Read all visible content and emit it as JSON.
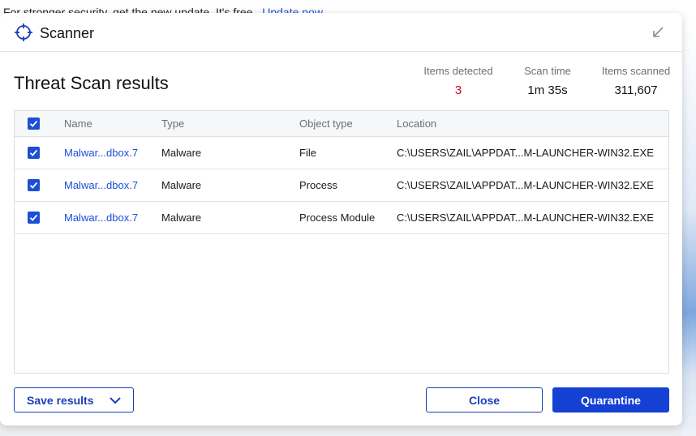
{
  "background": {
    "banner_text": "For stronger security, get the new update. It's free.",
    "banner_link": "Update now"
  },
  "header": {
    "title": "Scanner",
    "icon": "crosshair-icon",
    "minimize_icon": "minimize-arrow-icon"
  },
  "results": {
    "title": "Threat Scan results",
    "stats": {
      "items_detected_label": "Items detected",
      "items_detected_value": "3",
      "scan_time_label": "Scan time",
      "scan_time_value": "1m 35s",
      "items_scanned_label": "Items scanned",
      "items_scanned_value": "311,607"
    }
  },
  "table": {
    "columns": [
      "Name",
      "Type",
      "Object type",
      "Location"
    ],
    "rows": [
      {
        "name": "Malwar...dbox.7",
        "type": "Malware",
        "object_type": "File",
        "location": "C:\\USERS\\ZAIL\\APPDAT...M-LAUNCHER-WIN32.EXE",
        "checked": true
      },
      {
        "name": "Malwar...dbox.7",
        "type": "Malware",
        "object_type": "Process",
        "location": "C:\\USERS\\ZAIL\\APPDAT...M-LAUNCHER-WIN32.EXE",
        "checked": true
      },
      {
        "name": "Malwar...dbox.7",
        "type": "Malware",
        "object_type": "Process Module",
        "location": "C:\\USERS\\ZAIL\\APPDAT...M-LAUNCHER-WIN32.EXE",
        "checked": true
      }
    ]
  },
  "footer": {
    "save_label": "Save results",
    "close_label": "Close",
    "quarantine_label": "Quarantine"
  },
  "colors": {
    "accent": "#1540d4",
    "link": "#1a4fd6",
    "danger": "#d0021b"
  }
}
